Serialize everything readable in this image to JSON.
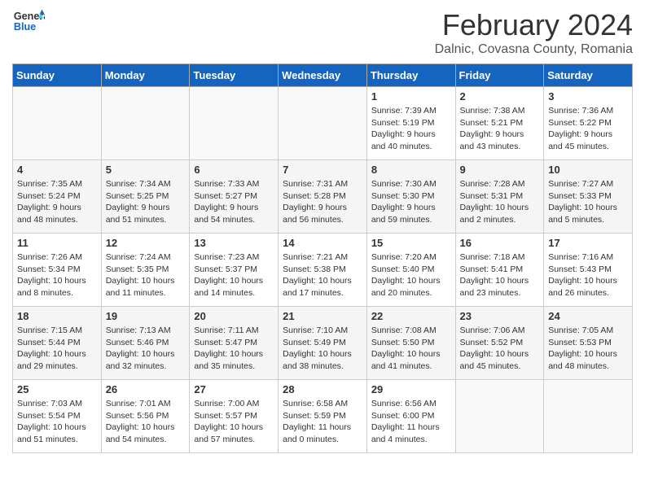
{
  "header": {
    "logo_general": "General",
    "logo_blue": "Blue",
    "month_title": "February 2024",
    "location": "Dalnic, Covasna County, Romania"
  },
  "weekdays": [
    "Sunday",
    "Monday",
    "Tuesday",
    "Wednesday",
    "Thursday",
    "Friday",
    "Saturday"
  ],
  "weeks": [
    [
      {
        "day": "",
        "info": ""
      },
      {
        "day": "",
        "info": ""
      },
      {
        "day": "",
        "info": ""
      },
      {
        "day": "",
        "info": ""
      },
      {
        "day": "1",
        "info": "Sunrise: 7:39 AM\nSunset: 5:19 PM\nDaylight: 9 hours\nand 40 minutes."
      },
      {
        "day": "2",
        "info": "Sunrise: 7:38 AM\nSunset: 5:21 PM\nDaylight: 9 hours\nand 43 minutes."
      },
      {
        "day": "3",
        "info": "Sunrise: 7:36 AM\nSunset: 5:22 PM\nDaylight: 9 hours\nand 45 minutes."
      }
    ],
    [
      {
        "day": "4",
        "info": "Sunrise: 7:35 AM\nSunset: 5:24 PM\nDaylight: 9 hours\nand 48 minutes."
      },
      {
        "day": "5",
        "info": "Sunrise: 7:34 AM\nSunset: 5:25 PM\nDaylight: 9 hours\nand 51 minutes."
      },
      {
        "day": "6",
        "info": "Sunrise: 7:33 AM\nSunset: 5:27 PM\nDaylight: 9 hours\nand 54 minutes."
      },
      {
        "day": "7",
        "info": "Sunrise: 7:31 AM\nSunset: 5:28 PM\nDaylight: 9 hours\nand 56 minutes."
      },
      {
        "day": "8",
        "info": "Sunrise: 7:30 AM\nSunset: 5:30 PM\nDaylight: 9 hours\nand 59 minutes."
      },
      {
        "day": "9",
        "info": "Sunrise: 7:28 AM\nSunset: 5:31 PM\nDaylight: 10 hours\nand 2 minutes."
      },
      {
        "day": "10",
        "info": "Sunrise: 7:27 AM\nSunset: 5:33 PM\nDaylight: 10 hours\nand 5 minutes."
      }
    ],
    [
      {
        "day": "11",
        "info": "Sunrise: 7:26 AM\nSunset: 5:34 PM\nDaylight: 10 hours\nand 8 minutes."
      },
      {
        "day": "12",
        "info": "Sunrise: 7:24 AM\nSunset: 5:35 PM\nDaylight: 10 hours\nand 11 minutes."
      },
      {
        "day": "13",
        "info": "Sunrise: 7:23 AM\nSunset: 5:37 PM\nDaylight: 10 hours\nand 14 minutes."
      },
      {
        "day": "14",
        "info": "Sunrise: 7:21 AM\nSunset: 5:38 PM\nDaylight: 10 hours\nand 17 minutes."
      },
      {
        "day": "15",
        "info": "Sunrise: 7:20 AM\nSunset: 5:40 PM\nDaylight: 10 hours\nand 20 minutes."
      },
      {
        "day": "16",
        "info": "Sunrise: 7:18 AM\nSunset: 5:41 PM\nDaylight: 10 hours\nand 23 minutes."
      },
      {
        "day": "17",
        "info": "Sunrise: 7:16 AM\nSunset: 5:43 PM\nDaylight: 10 hours\nand 26 minutes."
      }
    ],
    [
      {
        "day": "18",
        "info": "Sunrise: 7:15 AM\nSunset: 5:44 PM\nDaylight: 10 hours\nand 29 minutes."
      },
      {
        "day": "19",
        "info": "Sunrise: 7:13 AM\nSunset: 5:46 PM\nDaylight: 10 hours\nand 32 minutes."
      },
      {
        "day": "20",
        "info": "Sunrise: 7:11 AM\nSunset: 5:47 PM\nDaylight: 10 hours\nand 35 minutes."
      },
      {
        "day": "21",
        "info": "Sunrise: 7:10 AM\nSunset: 5:49 PM\nDaylight: 10 hours\nand 38 minutes."
      },
      {
        "day": "22",
        "info": "Sunrise: 7:08 AM\nSunset: 5:50 PM\nDaylight: 10 hours\nand 41 minutes."
      },
      {
        "day": "23",
        "info": "Sunrise: 7:06 AM\nSunset: 5:52 PM\nDaylight: 10 hours\nand 45 minutes."
      },
      {
        "day": "24",
        "info": "Sunrise: 7:05 AM\nSunset: 5:53 PM\nDaylight: 10 hours\nand 48 minutes."
      }
    ],
    [
      {
        "day": "25",
        "info": "Sunrise: 7:03 AM\nSunset: 5:54 PM\nDaylight: 10 hours\nand 51 minutes."
      },
      {
        "day": "26",
        "info": "Sunrise: 7:01 AM\nSunset: 5:56 PM\nDaylight: 10 hours\nand 54 minutes."
      },
      {
        "day": "27",
        "info": "Sunrise: 7:00 AM\nSunset: 5:57 PM\nDaylight: 10 hours\nand 57 minutes."
      },
      {
        "day": "28",
        "info": "Sunrise: 6:58 AM\nSunset: 5:59 PM\nDaylight: 11 hours\nand 0 minutes."
      },
      {
        "day": "29",
        "info": "Sunrise: 6:56 AM\nSunset: 6:00 PM\nDaylight: 11 hours\nand 4 minutes."
      },
      {
        "day": "",
        "info": ""
      },
      {
        "day": "",
        "info": ""
      }
    ]
  ]
}
